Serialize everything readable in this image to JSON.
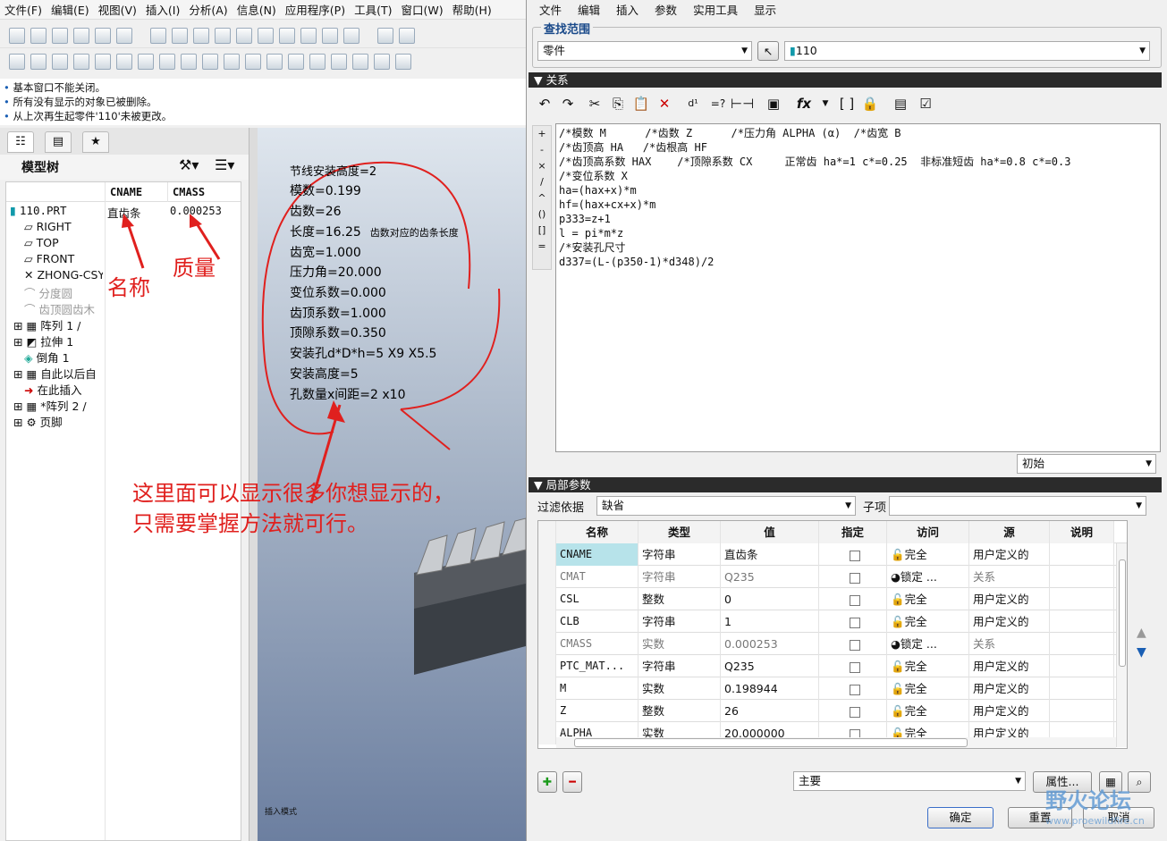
{
  "left_menu": [
    "文件(F)",
    "编辑(E)",
    "视图(V)",
    "插入(I)",
    "分析(A)",
    "信息(N)",
    "应用程序(P)",
    "工具(T)",
    "窗口(W)",
    "帮助(H)"
  ],
  "messages": [
    "基本窗口不能关闭。",
    "所有没有显示的对象已被删除。",
    "从上次再生起零件'110'未被更改。"
  ],
  "model_tree": {
    "title": "模型树",
    "columns": [
      "CNAME",
      "CMASS"
    ],
    "root": {
      "name": "110.PRT",
      "cname": "直齿条",
      "cmass": "0.000253"
    },
    "items": [
      "RIGHT",
      "TOP",
      "FRONT",
      "ZHONG-CSY",
      "分度圆",
      "齿顶圆齿木",
      "阵列 1 /",
      "拉伸 1",
      "倒角 1",
      "自此以后自",
      "在此插入",
      "*阵列 2 /",
      "页脚"
    ]
  },
  "annotations": {
    "name": "名称",
    "mass": "质量",
    "note_line1": "这里面可以显示很多你想显示的，",
    "note_line2": "只需要掌握方法就可行。"
  },
  "part_params": [
    "节线安装高度=2",
    "模数=0.199",
    "齿数=26",
    "长度=16.25",
    "齿宽=1.000",
    "压力角=20.000",
    "变位系数=0.000",
    "齿顶系数=1.000",
    "顶隙系数=0.350",
    "安装孔d*D*h=5 X9 X5.5",
    "安装高度=5",
    "孔数量x间距=2 x10"
  ],
  "length_note": "齿数对应的齿条长度",
  "viewport_label": "插入模式",
  "dialog": {
    "menu": [
      "文件",
      "编辑",
      "插入",
      "参数",
      "实用工具",
      "显示"
    ],
    "scope_title": "查找范围",
    "scope_value": "零件",
    "model_value": "110",
    "relations_title": "关系",
    "relations": [
      "/*模数 M      /*齿数 Z      /*压力角 ALPHA (α)  /*齿宽 B",
      "/*齿顶高 HA   /*齿根高 HF",
      "/*齿顶高系数 HAX    /*顶隙系数 CX     正常齿 ha*=1 c*=0.25  非标准短齿 ha*=0.8 c*=0.3",
      "/*变位系数 X",
      "ha=(hax+x)*m",
      "hf=(hax+cx+x)*m",
      "p333=z+1",
      "l = pi*m*z",
      "/*安装孔尺寸",
      "d337=(L-(p350-1)*d348)/2"
    ],
    "side_buttons": [
      "+",
      "-",
      "×",
      "/",
      "^",
      "()",
      "[]",
      "="
    ],
    "initial_value": "初始",
    "local_params_title": "局部参数",
    "filter_label": "过滤依据",
    "filter_value": "缺省",
    "child_label": "子项",
    "columns": [
      "名称",
      "类型",
      "值",
      "指定",
      "访问",
      "源",
      "说明"
    ],
    "rows": [
      [
        "CNAME",
        "字符串",
        "直齿条",
        "完全",
        "用户定义的"
      ],
      [
        "CMAT",
        "字符串",
        "Q235",
        "锁定 ...",
        "关系"
      ],
      [
        "CSL",
        "整数",
        "0",
        "完全",
        "用户定义的"
      ],
      [
        "CLB",
        "字符串",
        "1",
        "完全",
        "用户定义的"
      ],
      [
        "CMASS",
        "实数",
        "0.000253",
        "锁定 ...",
        "关系"
      ],
      [
        "PTC_MAT...",
        "字符串",
        "Q235",
        "完全",
        "用户定义的"
      ],
      [
        "M",
        "实数",
        "0.198944",
        "完全",
        "用户定义的"
      ],
      [
        "Z",
        "整数",
        "26",
        "完全",
        "用户定义的"
      ],
      [
        "ALPHA",
        "实数",
        "20.000000",
        "完全",
        "用户定义的"
      ]
    ],
    "main_value": "主要",
    "properties_label": "属性...",
    "ok_label": "确定",
    "reset_label": "重置",
    "cancel_label": "取消",
    "watermark": "野火论坛",
    "watermark_url": "www.proewildfire.cn"
  }
}
